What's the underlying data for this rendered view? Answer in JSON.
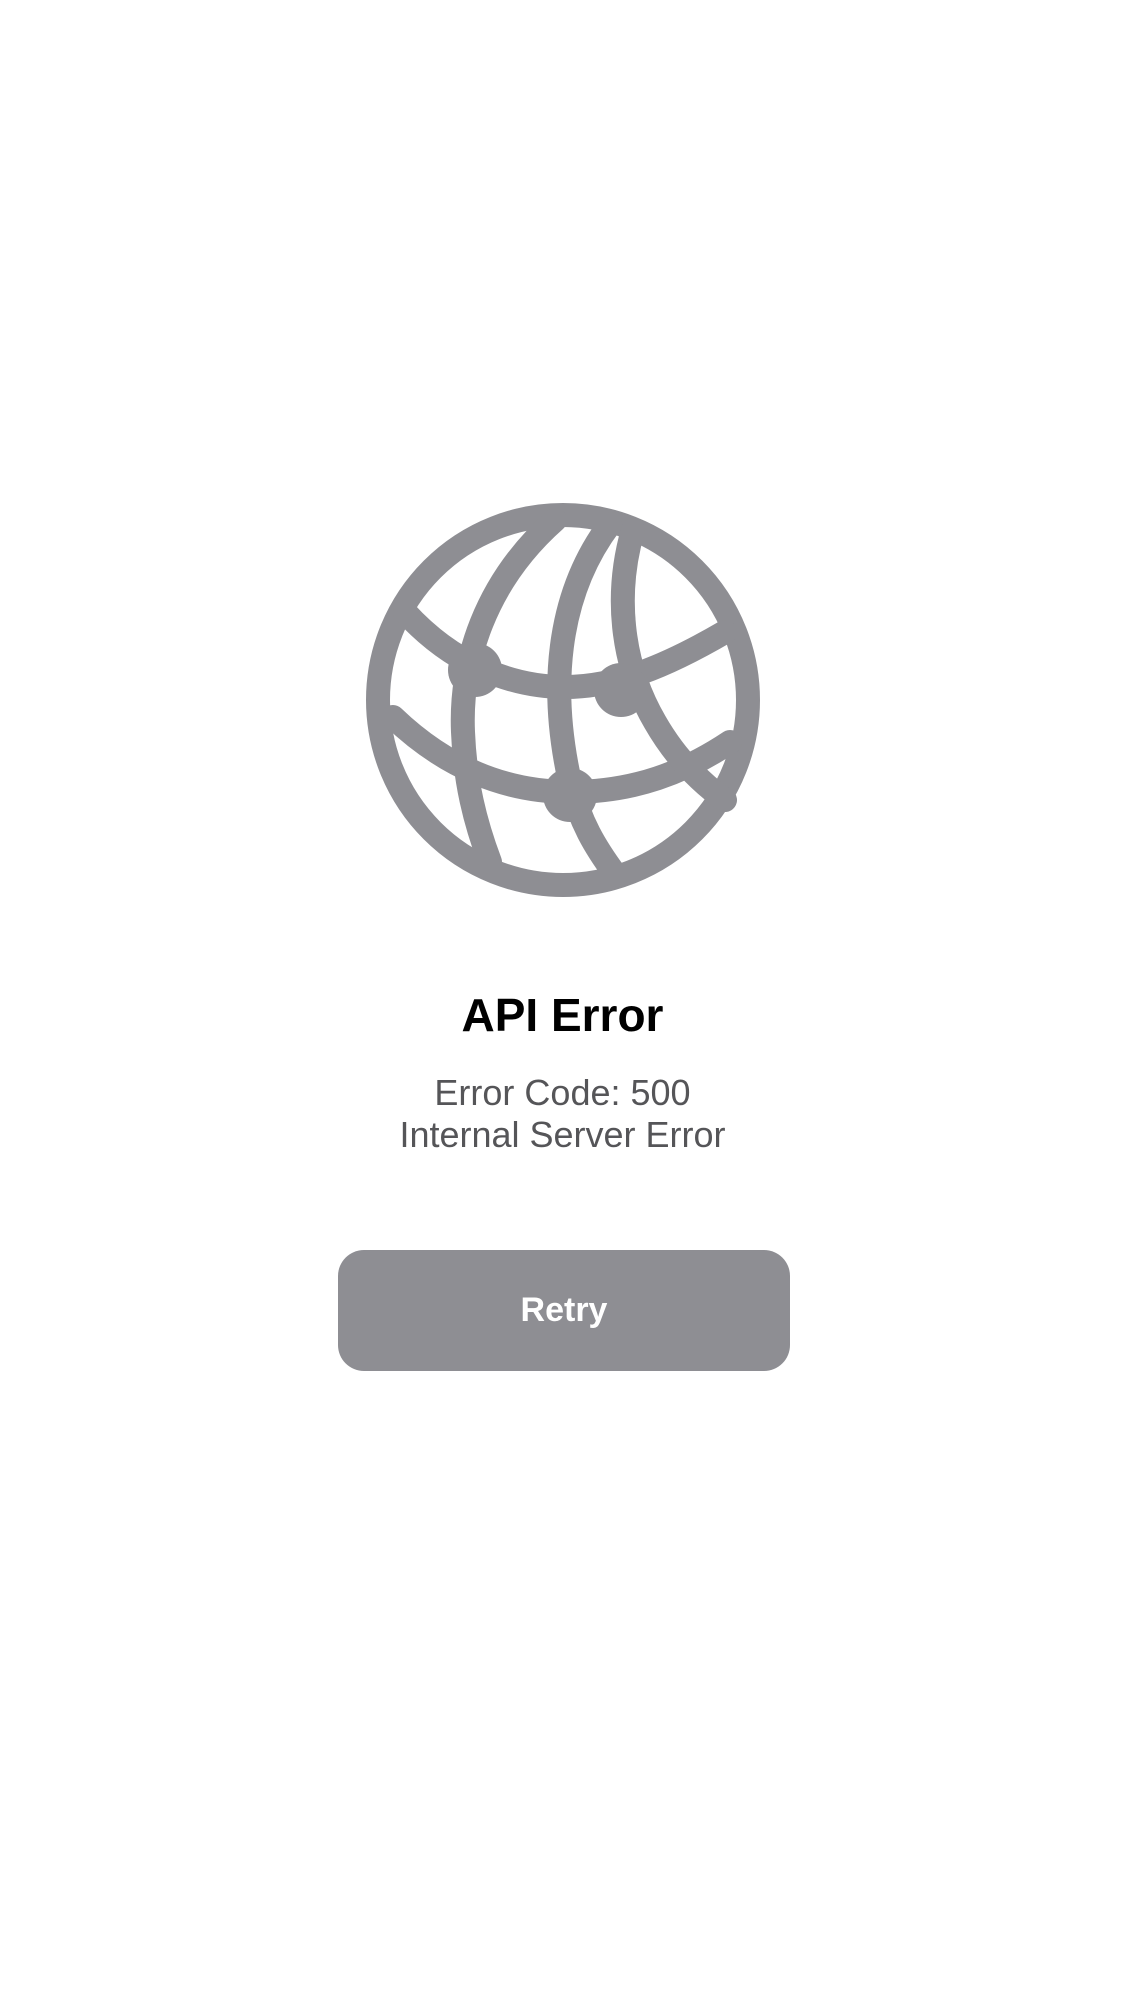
{
  "error": {
    "icon": "globe-network-icon",
    "title": "API Error",
    "code_line": "Error Code: 500",
    "message_line": "Internal Server Error"
  },
  "actions": {
    "retry_label": "Retry"
  },
  "colors": {
    "icon_gray": "#8e8e93",
    "button_bg": "#8e8e93",
    "title": "#000000",
    "subtitle": "#555558",
    "background": "#ffffff"
  }
}
